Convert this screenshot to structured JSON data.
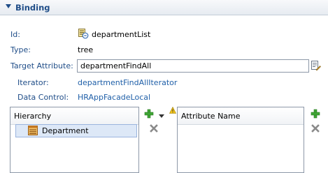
{
  "section": {
    "title": "Binding"
  },
  "fields": {
    "id_label": "Id:",
    "id_value": "departmentList",
    "type_label": "Type:",
    "type_value": "tree",
    "target_label": "Target Attribute:",
    "target_value": "departmentFindAll",
    "iterator_label": "Iterator:",
    "iterator_value": "departmentFindAllIterator",
    "datacontrol_label": "Data Control:",
    "datacontrol_value": "HRAppFacadeLocal"
  },
  "hierarchy": {
    "header": "Hierarchy",
    "nodes": [
      {
        "label": "Department"
      }
    ]
  },
  "attributes": {
    "header": "Attribute Name"
  },
  "icons": {
    "id": "binding-list-icon",
    "target_edit": "edit-document-icon",
    "add": "green-plus-icon",
    "remove": "gray-x-icon",
    "warning": "warning-icon"
  },
  "colors": {
    "label": "#1f4d88",
    "link": "#1f5fa8",
    "add": "#3fa535",
    "remove": "#8a8a8a"
  }
}
